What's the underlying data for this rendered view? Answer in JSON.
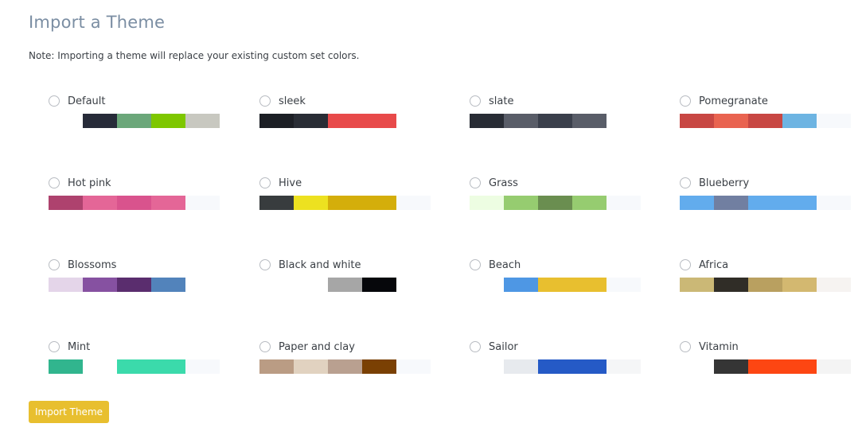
{
  "header": {
    "title": "Import a Theme",
    "note": "Note: Importing a theme will replace your existing custom set colors."
  },
  "themes": [
    {
      "name": "Default",
      "selected": false,
      "colors": [
        null,
        "#272b39",
        "#6ba77a",
        "#7ec700",
        "#c8c8c0"
      ]
    },
    {
      "name": "sleek",
      "selected": false,
      "colors": [
        "#1c1f25",
        "#292d35",
        "#e84a4a",
        "#e84a4a",
        null
      ]
    },
    {
      "name": "slate",
      "selected": false,
      "colors": [
        "#282c35",
        "#595d68",
        "#3a3f4b",
        "#595d68",
        null
      ]
    },
    {
      "name": "Pomegranate",
      "selected": false,
      "colors": [
        "#c84743",
        "#e96350",
        "#c84743",
        "#6db4e2",
        "#f7f9fc"
      ]
    },
    {
      "name": "Hot pink",
      "selected": false,
      "colors": [
        "#ae426e",
        "#e46697",
        "#d9538d",
        "#e46697",
        "#f7f9fc"
      ]
    },
    {
      "name": "Hive",
      "selected": false,
      "colors": [
        "#383c3e",
        "#ede120",
        "#d4ae0b",
        "#d4ae0b",
        "#f7f9fc"
      ]
    },
    {
      "name": "Grass",
      "selected": false,
      "colors": [
        "#edfde2",
        "#96cc70",
        "#6a8e50",
        "#96cc70",
        "#f7f9fc"
      ]
    },
    {
      "name": "Blueberry",
      "selected": false,
      "colors": [
        "#62aced",
        "#717fa1",
        "#62aced",
        "#62aced",
        "#f7f9fc"
      ]
    },
    {
      "name": "Blossoms",
      "selected": false,
      "colors": [
        "#e4d5e9",
        "#8651a1",
        "#5a2d6e",
        "#5283bb",
        null
      ]
    },
    {
      "name": "Black and white",
      "selected": false,
      "colors": [
        null,
        null,
        "#a6a6a6",
        "#06070b",
        null
      ]
    },
    {
      "name": "Beach",
      "selected": false,
      "colors": [
        null,
        "#4e97e4",
        "#e8bf2f",
        "#e8bf2f",
        "#f7f9fc"
      ]
    },
    {
      "name": "Africa",
      "selected": false,
      "colors": [
        "#cbb876",
        "#302d27",
        "#b9a060",
        "#d3b870",
        "#f6f3f1"
      ]
    },
    {
      "name": "Mint",
      "selected": false,
      "colors": [
        "#31b58e",
        null,
        "#3bdaab",
        "#3bdaab",
        "#f7f9fc"
      ]
    },
    {
      "name": "Paper and clay",
      "selected": false,
      "colors": [
        "#ba9c84",
        "#e1d2c0",
        "#b9a090",
        "#7a4003",
        "#f7f9fc"
      ]
    },
    {
      "name": "Sailor",
      "selected": false,
      "colors": [
        null,
        "#e7eaee",
        "#255ac6",
        "#255ac6",
        "#f5f6f7"
      ]
    },
    {
      "name": "Vitamin",
      "selected": false,
      "colors": [
        null,
        "#353535",
        "#fd4612",
        "#fd4612",
        "#f4f4f4"
      ]
    }
  ],
  "actions": {
    "import_label": "Import Theme"
  }
}
